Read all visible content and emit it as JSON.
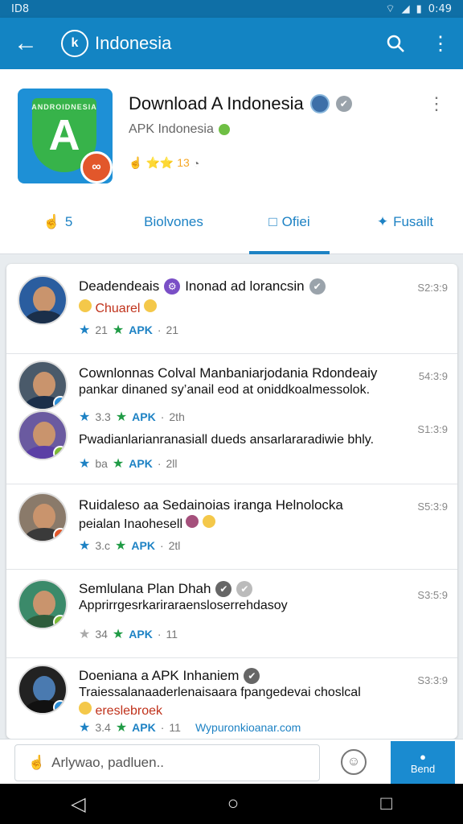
{
  "status": {
    "left": "ID8",
    "right": "0:49"
  },
  "appbar": {
    "title": "Indonesia",
    "back_icon": "arrow-left-icon",
    "search_icon": "search-icon",
    "more_icon": "more-vert-icon",
    "logo_icon": "app-logo-icon"
  },
  "app": {
    "title": "Download A Indonesia",
    "subtitle": "APK Indonesia",
    "rating": "⭐⭐ 13",
    "icon_banner": "ANDROIDNESIA",
    "icon_letter": "A",
    "icon_badge": "∞"
  },
  "tabs": [
    {
      "icon": "☝",
      "label": "5"
    },
    {
      "icon": "",
      "label": "Biolvones"
    },
    {
      "icon": "□",
      "label": "Ofiei"
    },
    {
      "icon": "✦",
      "label": "Fusailt"
    }
  ],
  "posts": [
    {
      "name": "Deadendeais",
      "tag": "Inonad ad lorancsin",
      "text": "Chuarel",
      "rating": "21",
      "apk": "APK",
      "count": "21",
      "time": "S2:3:9"
    },
    {
      "name": "Cownlonnas Colval Manbaniarjodania Rdondeaiy",
      "text": "pankar dinaned sy’anail eod at oniddkoalmessolok.",
      "rating": "3.3",
      "apk": "APK",
      "count": "2th",
      "time": "54:3:9"
    },
    {
      "name": "",
      "text": "Pwadianlarianranasiall dueds ansarlararadiwie bhly.",
      "rating": "ba",
      "apk": "APK",
      "count": "2ll",
      "time": "S1:3:9"
    },
    {
      "name": "Ruidaleso aa Sedainoias iranga Helnolocka",
      "text": "peialan Inaohesell",
      "rating": "3.c",
      "apk": "APK",
      "count": "2tl",
      "time": "S5:3:9"
    },
    {
      "name": "Semlulana Plan Dhah",
      "text": "Apprirrgesrkariraraensloserrehdasoy",
      "rating": "34",
      "apk": "APK",
      "count": "11",
      "time": "S3:5:9"
    },
    {
      "name": "Doeniana a APK Inhaniem",
      "text": "Traiessalanaaderlenaisaara fpangedevai choslcal",
      "red": "ereslebroek",
      "rating": "3.4",
      "apk": "APK",
      "count": "11",
      "time": "S3:3:9",
      "link": "Wypuronkioanar.com"
    }
  ],
  "composer": {
    "placeholder": "Arlywao, padluen..",
    "send_label": "Bend"
  },
  "colors": {
    "primary": "#1384c3",
    "accent": "#1d82c4",
    "green": "#1f9b45"
  }
}
